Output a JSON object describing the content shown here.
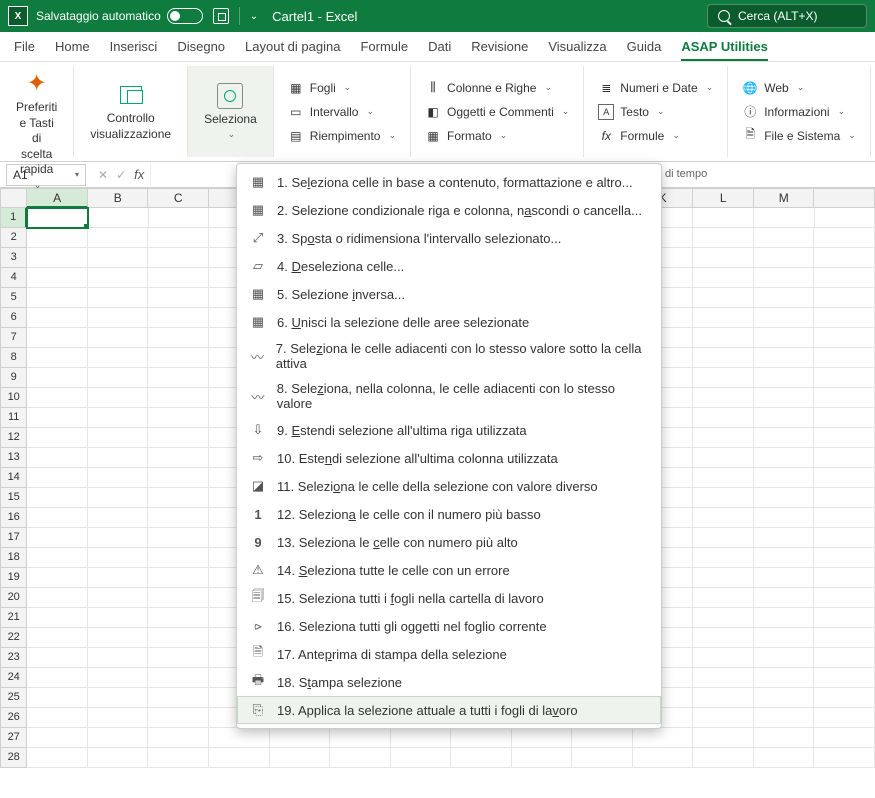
{
  "titlebar": {
    "autosave": "Salvataggio automatico",
    "doc_title": "Cartel1  -  Excel",
    "search_placeholder": "Cerca (ALT+X)"
  },
  "tabs": {
    "file": "File",
    "home": "Home",
    "inserisci": "Inserisci",
    "disegno": "Disegno",
    "layout": "Layout di pagina",
    "formule": "Formule",
    "dati": "Dati",
    "revisione": "Revisione",
    "visualizza": "Visualizza",
    "guida": "Guida",
    "asap": "ASAP Utilities"
  },
  "ribbon": {
    "preferiti_btn": "Preferiti e Tasti di scelta rapida",
    "preferiti_label": "Preferiti",
    "controllo": "Controllo visualizzazione",
    "seleziona": "Seleziona",
    "fogli": "Fogli",
    "intervallo": "Intervallo",
    "riempimento": "Riempimento",
    "colonne": "Colonne e Righe",
    "oggetti": "Oggetti e Commenti",
    "formato": "Formato",
    "numeri": "Numeri e Date",
    "testo": "Testo",
    "formule_cmd": "Formule",
    "web": "Web",
    "info": "Informazioni",
    "filesys": "File e Sistema",
    "tempo_fragment": "di tempo"
  },
  "namebox": "A1",
  "columns": [
    "A",
    "B",
    "C",
    "",
    "",
    "",
    "",
    "",
    "",
    "",
    "K",
    "L",
    "M",
    ""
  ],
  "rows": [
    "1",
    "2",
    "3",
    "4",
    "5",
    "6",
    "7",
    "8",
    "9",
    "10",
    "11",
    "12",
    "13",
    "14",
    "15",
    "16",
    "17",
    "18",
    "19",
    "20",
    "21",
    "22",
    "23",
    "24",
    "25",
    "26",
    "27",
    "28"
  ],
  "menu": [
    {
      "n": "1.",
      "t_pre": "Se",
      "u": "l",
      "t_post": "eziona celle in base a contenuto, formattazione e altro...",
      "icon": "grid"
    },
    {
      "n": "2.",
      "t_pre": "Selezione condizionale riga e colonna, n",
      "u": "a",
      "t_post": "scondi o cancella...",
      "icon": "grid"
    },
    {
      "n": "3.",
      "t_pre": "Sp",
      "u": "o",
      "t_post": "sta o ridimensiona l'intervallo selezionato...",
      "icon": "move"
    },
    {
      "n": "4.",
      "t_pre": "",
      "u": "D",
      "t_post": "eseleziona celle...",
      "icon": "desel"
    },
    {
      "n": "5.",
      "t_pre": "Selezione ",
      "u": "i",
      "t_post": "nversa...",
      "icon": "grid"
    },
    {
      "n": "6.",
      "t_pre": "",
      "u": "U",
      "t_post": "nisci la selezione delle aree selezionate",
      "icon": "grid"
    },
    {
      "n": "7.",
      "t_pre": "Sele",
      "u": "z",
      "t_post": "iona le celle adiacenti con lo stesso valore sotto la cella attiva",
      "icon": "curve"
    },
    {
      "n": "8.",
      "t_pre": "Sele",
      "u": "z",
      "t_post": "iona, nella colonna, le celle adiacenti con lo stesso valore",
      "icon": "curve"
    },
    {
      "n": "9.",
      "t_pre": "",
      "u": "E",
      "t_post": "stendi selezione all'ultima riga utilizzata",
      "icon": "down"
    },
    {
      "n": "10.",
      "t_pre": "Este",
      "u": "n",
      "t_post": "di selezione all'ultima colonna utilizzata",
      "icon": "right"
    },
    {
      "n": "11.",
      "t_pre": "Selezi",
      "u": "o",
      "t_post": "na le celle della selezione con valore diverso",
      "icon": "diff"
    },
    {
      "n": "12.",
      "t_pre": "Selezion",
      "u": "a",
      "t_post": " le celle con il numero più basso",
      "icon": "1"
    },
    {
      "n": "13.",
      "t_pre": "Seleziona le ",
      "u": "c",
      "t_post": "elle con numero più alto",
      "icon": "9"
    },
    {
      "n": "14.",
      "t_pre": "",
      "u": "S",
      "t_post": "eleziona tutte le celle con un errore",
      "icon": "warn"
    },
    {
      "n": "15.",
      "t_pre": "Seleziona tutti i ",
      "u": "f",
      "t_post": "ogli nella cartella di lavoro",
      "icon": "sheets"
    },
    {
      "n": "16.",
      "t_pre": "Seleziona tutti ",
      "u": "g",
      "t_post": "li oggetti nel foglio corrente",
      "icon": "obj"
    },
    {
      "n": "17.",
      "t_pre": "Ante",
      "u": "p",
      "t_post": "rima di stampa della selezione",
      "icon": "preview"
    },
    {
      "n": "18.",
      "t_pre": "S",
      "u": "t",
      "t_post": "ampa selezione",
      "icon": "print"
    },
    {
      "n": "19.",
      "t_pre": "Applica la selezione attuale a tutti i fogli di la",
      "u": "v",
      "t_post": "oro",
      "icon": "apply",
      "hover": true
    }
  ]
}
